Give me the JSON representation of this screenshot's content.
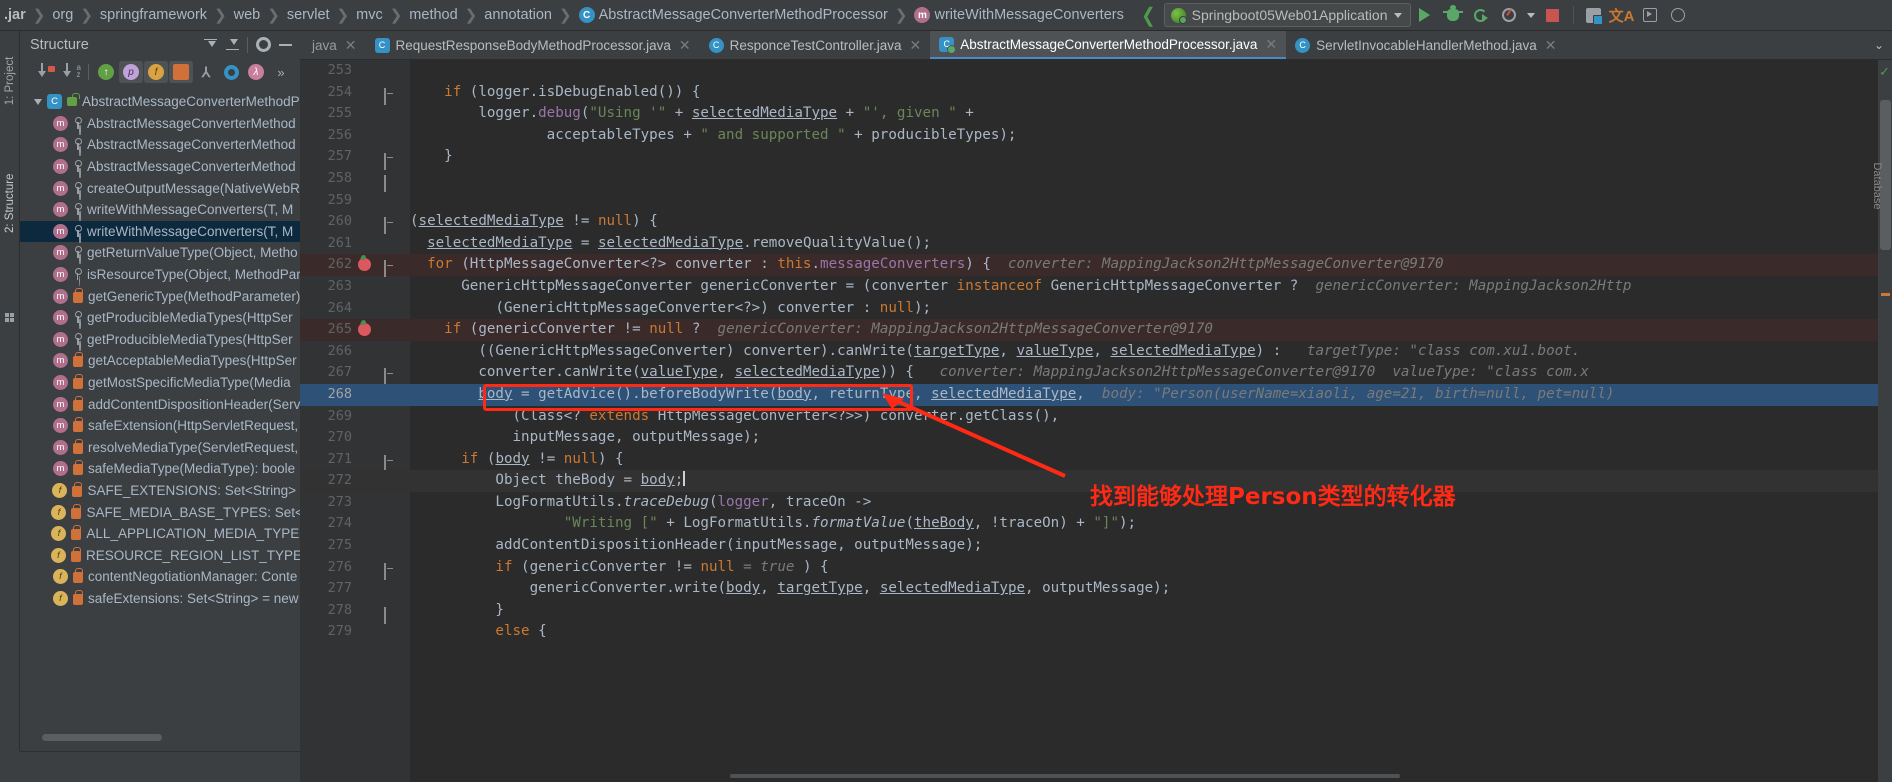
{
  "breadcrumbs": [
    {
      "label": ".jar",
      "icon": null
    },
    {
      "label": "org",
      "icon": null
    },
    {
      "label": "springframework",
      "icon": null
    },
    {
      "label": "web",
      "icon": null
    },
    {
      "label": "servlet",
      "icon": null
    },
    {
      "label": "mvc",
      "icon": null
    },
    {
      "label": "method",
      "icon": null
    },
    {
      "label": "annotation",
      "icon": null
    },
    {
      "label": "AbstractMessageConverterMethodProcessor",
      "icon": "class-icon"
    },
    {
      "label": "writeWithMessageConverters",
      "icon": "method-icon"
    }
  ],
  "toolbar": {
    "run_config": "Springboot05Web01Application",
    "icons": [
      "back-chevron-icon",
      "run-icon",
      "debug-icon",
      "rerun-icon",
      "coverage-icon",
      "stop-icon",
      "layers-icon",
      "translate-icon",
      "terminal-icon",
      "circle-icon"
    ]
  },
  "left_strip": {
    "project_label": "1: Project",
    "structure_label": "2: Structure"
  },
  "structure": {
    "title": "Structure",
    "toolbar_icons": [
      "sort-by-visibility-icon",
      "sort-alphabetically-icon",
      "inherited-icon",
      "properties-icon",
      "fields-icon",
      "non-public-icon",
      "show-hierarchy-icon",
      "anonymous-icon",
      "lambda-icon",
      "more-icon"
    ],
    "tree": [
      {
        "label": "AbstractMessageConverterMethodPro",
        "icon": "class-icon",
        "vis": "lock-green",
        "depth": 0,
        "expanded": true,
        "selected": false
      },
      {
        "label": "AbstractMessageConverterMethod",
        "icon": "method-icon",
        "vis": "public",
        "depth": 1,
        "selected": false
      },
      {
        "label": "AbstractMessageConverterMethod",
        "icon": "method-icon",
        "vis": "public",
        "depth": 1,
        "selected": false
      },
      {
        "label": "AbstractMessageConverterMethod",
        "icon": "method-icon",
        "vis": "public",
        "depth": 1,
        "selected": false
      },
      {
        "label": "createOutputMessage(NativeWebR",
        "icon": "method-icon",
        "vis": "public",
        "depth": 1,
        "selected": false
      },
      {
        "label": "writeWithMessageConverters(T, M",
        "icon": "method-icon",
        "vis": "public",
        "depth": 1,
        "selected": false
      },
      {
        "label": "writeWithMessageConverters(T, M",
        "icon": "method-icon",
        "vis": "public",
        "depth": 1,
        "selected": true
      },
      {
        "label": "getReturnValueType(Object, Metho",
        "icon": "method-icon",
        "vis": "public",
        "depth": 1,
        "selected": false
      },
      {
        "label": "isResourceType(Object, MethodPar",
        "icon": "method-icon",
        "vis": "public",
        "depth": 1,
        "selected": false
      },
      {
        "label": "getGenericType(MethodParameter)",
        "icon": "method-icon",
        "vis": "private",
        "depth": 1,
        "selected": false
      },
      {
        "label": "getProducibleMediaTypes(HttpSer",
        "icon": "method-icon",
        "vis": "public",
        "depth": 1,
        "selected": false
      },
      {
        "label": "getProducibleMediaTypes(HttpSer",
        "icon": "method-icon",
        "vis": "public",
        "depth": 1,
        "selected": false
      },
      {
        "label": "getAcceptableMediaTypes(HttpSer",
        "icon": "method-icon",
        "vis": "private",
        "depth": 1,
        "selected": false
      },
      {
        "label": "getMostSpecificMediaType(Media",
        "icon": "method-icon",
        "vis": "private",
        "depth": 1,
        "selected": false
      },
      {
        "label": "addContentDispositionHeader(Serv",
        "icon": "method-icon",
        "vis": "private",
        "depth": 1,
        "selected": false
      },
      {
        "label": "safeExtension(HttpServletRequest,",
        "icon": "method-icon",
        "vis": "private",
        "depth": 1,
        "selected": false
      },
      {
        "label": "resolveMediaType(ServletRequest,",
        "icon": "method-icon",
        "vis": "private",
        "depth": 1,
        "selected": false
      },
      {
        "label": "safeMediaType(MediaType): boole",
        "icon": "method-icon",
        "vis": "private",
        "depth": 1,
        "selected": false
      },
      {
        "label": "SAFE_EXTENSIONS: Set<String> = ",
        "icon": "field-icon",
        "vis": "private",
        "depth": 1,
        "selected": false
      },
      {
        "label": "SAFE_MEDIA_BASE_TYPES: Set<Stri",
        "icon": "field-icon",
        "vis": "private",
        "depth": 1,
        "selected": false
      },
      {
        "label": "ALL_APPLICATION_MEDIA_TYPES: L",
        "icon": "field-icon",
        "vis": "private",
        "depth": 1,
        "selected": false
      },
      {
        "label": "RESOURCE_REGION_LIST_TYPE: Typ",
        "icon": "field-icon",
        "vis": "private",
        "depth": 1,
        "selected": false
      },
      {
        "label": "contentNegotiationManager: Conte",
        "icon": "field-icon",
        "vis": "private",
        "depth": 1,
        "selected": false
      },
      {
        "label": "safeExtensions: Set<String> = new",
        "icon": "field-icon",
        "vis": "private",
        "depth": 1,
        "selected": false
      }
    ]
  },
  "tabs": [
    {
      "label": "java",
      "icon": null,
      "active": false,
      "closable": true
    },
    {
      "label": "RequestResponseBodyMethodProcessor.java",
      "icon": "java-class-icon",
      "active": false,
      "closable": true
    },
    {
      "label": "ResponceTestController.java",
      "icon": "java-class-icon",
      "active": false,
      "closable": true
    },
    {
      "label": "AbstractMessageConverterMethodProcessor.java",
      "icon": "java-debug-class-icon",
      "active": true,
      "closable": true
    },
    {
      "label": "ServletInvocableHandlerMethod.java",
      "icon": "java-class-icon",
      "active": false,
      "closable": true
    }
  ],
  "code": {
    "first_line": 253,
    "lines": [
      {
        "n": 253,
        "fold": null,
        "bp": false,
        "hl": null,
        "html": ""
      },
      {
        "n": 254,
        "fold": "open",
        "bp": false,
        "hl": null,
        "html": "<span class=\"ind\">    </span><span class=\"kw\">if</span> (logger.isDebugEnabled()) {"
      },
      {
        "n": 255,
        "fold": null,
        "bp": false,
        "hl": null,
        "html": "        logger.<span class=\"fld\">debug</span>(<span class=\"str\">\"Using '\"</span> + <span class=\"ul\">selectedMediaType</span> + <span class=\"str\">\"', given \"</span> +"
      },
      {
        "n": 256,
        "fold": null,
        "bp": false,
        "hl": null,
        "html": "                acceptableTypes + <span class=\"str\">\" and supported \"</span> + producibleTypes);"
      },
      {
        "n": 257,
        "fold": "close",
        "bp": false,
        "hl": null,
        "html": "    }"
      },
      {
        "n": 258,
        "fold": "bar",
        "bp": false,
        "hl": null,
        "html": ""
      },
      {
        "n": 259,
        "fold": null,
        "bp": false,
        "hl": null,
        "html": ""
      },
      {
        "n": 260,
        "fold": "open",
        "bp": false,
        "hl": null,
        "html": "(<span class=\"ul\">selectedMediaType</span> != <span class=\"kw\">null</span>) {"
      },
      {
        "n": 261,
        "fold": null,
        "bp": false,
        "hl": null,
        "html": "  <span class=\"ul\">selectedMediaType</span> = <span class=\"ul\">selectedMediaType</span>.removeQualityValue();"
      },
      {
        "n": 262,
        "fold": "open",
        "bp": true,
        "hl": "break",
        "html": "  <span class=\"kw\">for</span> (HttpMessageConverter&lt;?&gt; converter : <span class=\"kw\">this</span>.<span class=\"fld\">messageConverters</span>) {  <span class=\"cmt-hint\">converter: MappingJackson2HttpMessageConverter@9170</span>"
      },
      {
        "n": 263,
        "fold": null,
        "bp": false,
        "hl": null,
        "html": "      GenericHttpMessageConverter genericConverter = (converter <span class=\"kw\">instanceof</span> GenericHttpMessageConverter ?  <span class=\"cmt-hint\">genericConverter: MappingJackson2Http</span>"
      },
      {
        "n": 264,
        "fold": null,
        "bp": false,
        "hl": null,
        "html": "          (GenericHttpMessageConverter&lt;?&gt;) converter : <span class=\"kw\">null</span>);"
      },
      {
        "n": 265,
        "fold": null,
        "bp": true,
        "hl": "break",
        "html": "    <span class=\"kw\">if</span> (genericConverter != <span class=\"kw\">null</span> ?  <span class=\"cmt-hint\">genericConverter: MappingJackson2HttpMessageConverter@9170</span>"
      },
      {
        "n": 266,
        "fold": null,
        "bp": false,
        "hl": null,
        "html": "        ((GenericHttpMessageConverter) converter).canWrite(<span class=\"ul\">targetType</span>, <span class=\"ul\">valueType</span>, <span class=\"ul\">selectedMediaType</span>) :   <span class=\"cmt-hint\">targetType: \"class com.xu1.boot.</span>"
      },
      {
        "n": 267,
        "fold": "open",
        "bp": false,
        "hl": null,
        "html": "        converter.canWrite(<span class=\"ul\">valueType</span>, <span class=\"ul\">selectedMediaType</span>)) {   <span class=\"cmt-hint\">converter: MappingJackson2HttpMessageConverter@9170  valueType: \"class com.x</span>"
      },
      {
        "n": 268,
        "fold": null,
        "bp": false,
        "hl": "select",
        "html": "        <span class=\"ul\">body</span> = getAdvice().beforeBodyWrite(<span class=\"ul\">body</span>, returnType, <span class=\"ul\">selectedMediaType</span>,  <span class=\"cmt-hint\">body: \"Person(userName=xiaoli, age=21, birth=null, pet=null)</span>"
      },
      {
        "n": 269,
        "fold": null,
        "bp": false,
        "hl": null,
        "html": "            (Class&lt;? <span class=\"kw\">extends</span> HttpMessageConverter&lt;?&gt;&gt;) converter.getClass(),"
      },
      {
        "n": 270,
        "fold": null,
        "bp": false,
        "hl": null,
        "html": "            inputMessage, outputMessage);"
      },
      {
        "n": 271,
        "fold": "open",
        "bp": false,
        "hl": null,
        "html": "      <span class=\"kw\">if</span> (<span class=\"ul\">body</span> != <span class=\"kw\">null</span>) {"
      },
      {
        "n": 272,
        "fold": null,
        "bp": false,
        "hl": "cursor",
        "html": "          Object theBody = <span class=\"ul\">body</span>;<span class=\"caret-bar\"></span>"
      },
      {
        "n": 273,
        "fold": null,
        "bp": false,
        "hl": null,
        "html": "          LogFormatUtils.<span class=\"ital\">traceDebug</span>(<span class=\"fld\">logger</span>, traceOn -&gt;"
      },
      {
        "n": 274,
        "fold": null,
        "bp": false,
        "hl": null,
        "html": "                  <span class=\"str\">\"Writing [\"</span> + LogFormatUtils.<span class=\"ital\">formatValue</span>(<span class=\"ul\">theBody</span>, !traceOn) + <span class=\"str\">\"]\"</span>);"
      },
      {
        "n": 275,
        "fold": null,
        "bp": false,
        "hl": null,
        "html": "          addContentDispositionHeader(inputMessage, outputMessage);"
      },
      {
        "n": 276,
        "fold": "open",
        "bp": false,
        "hl": null,
        "html": "          <span class=\"kw\">if</span> (genericConverter != <span class=\"kw\">null</span> <span class=\"cmt-hint\">= true</span> ) {"
      },
      {
        "n": 277,
        "fold": null,
        "bp": false,
        "hl": null,
        "html": "              genericConverter.write(<span class=\"ul\">body</span>, <span class=\"ul\">targetType</span>, <span class=\"ul\">selectedMediaType</span>, outputMessage);"
      },
      {
        "n": 278,
        "fold": "bar",
        "bp": false,
        "hl": null,
        "html": "          }"
      },
      {
        "n": 279,
        "fold": null,
        "bp": false,
        "hl": null,
        "html": "          <span class=\"kw\">else</span> {"
      }
    ]
  },
  "annotation": {
    "note_text": "找到能够处理Person类型的转化器",
    "color": "#ff2a15"
  }
}
